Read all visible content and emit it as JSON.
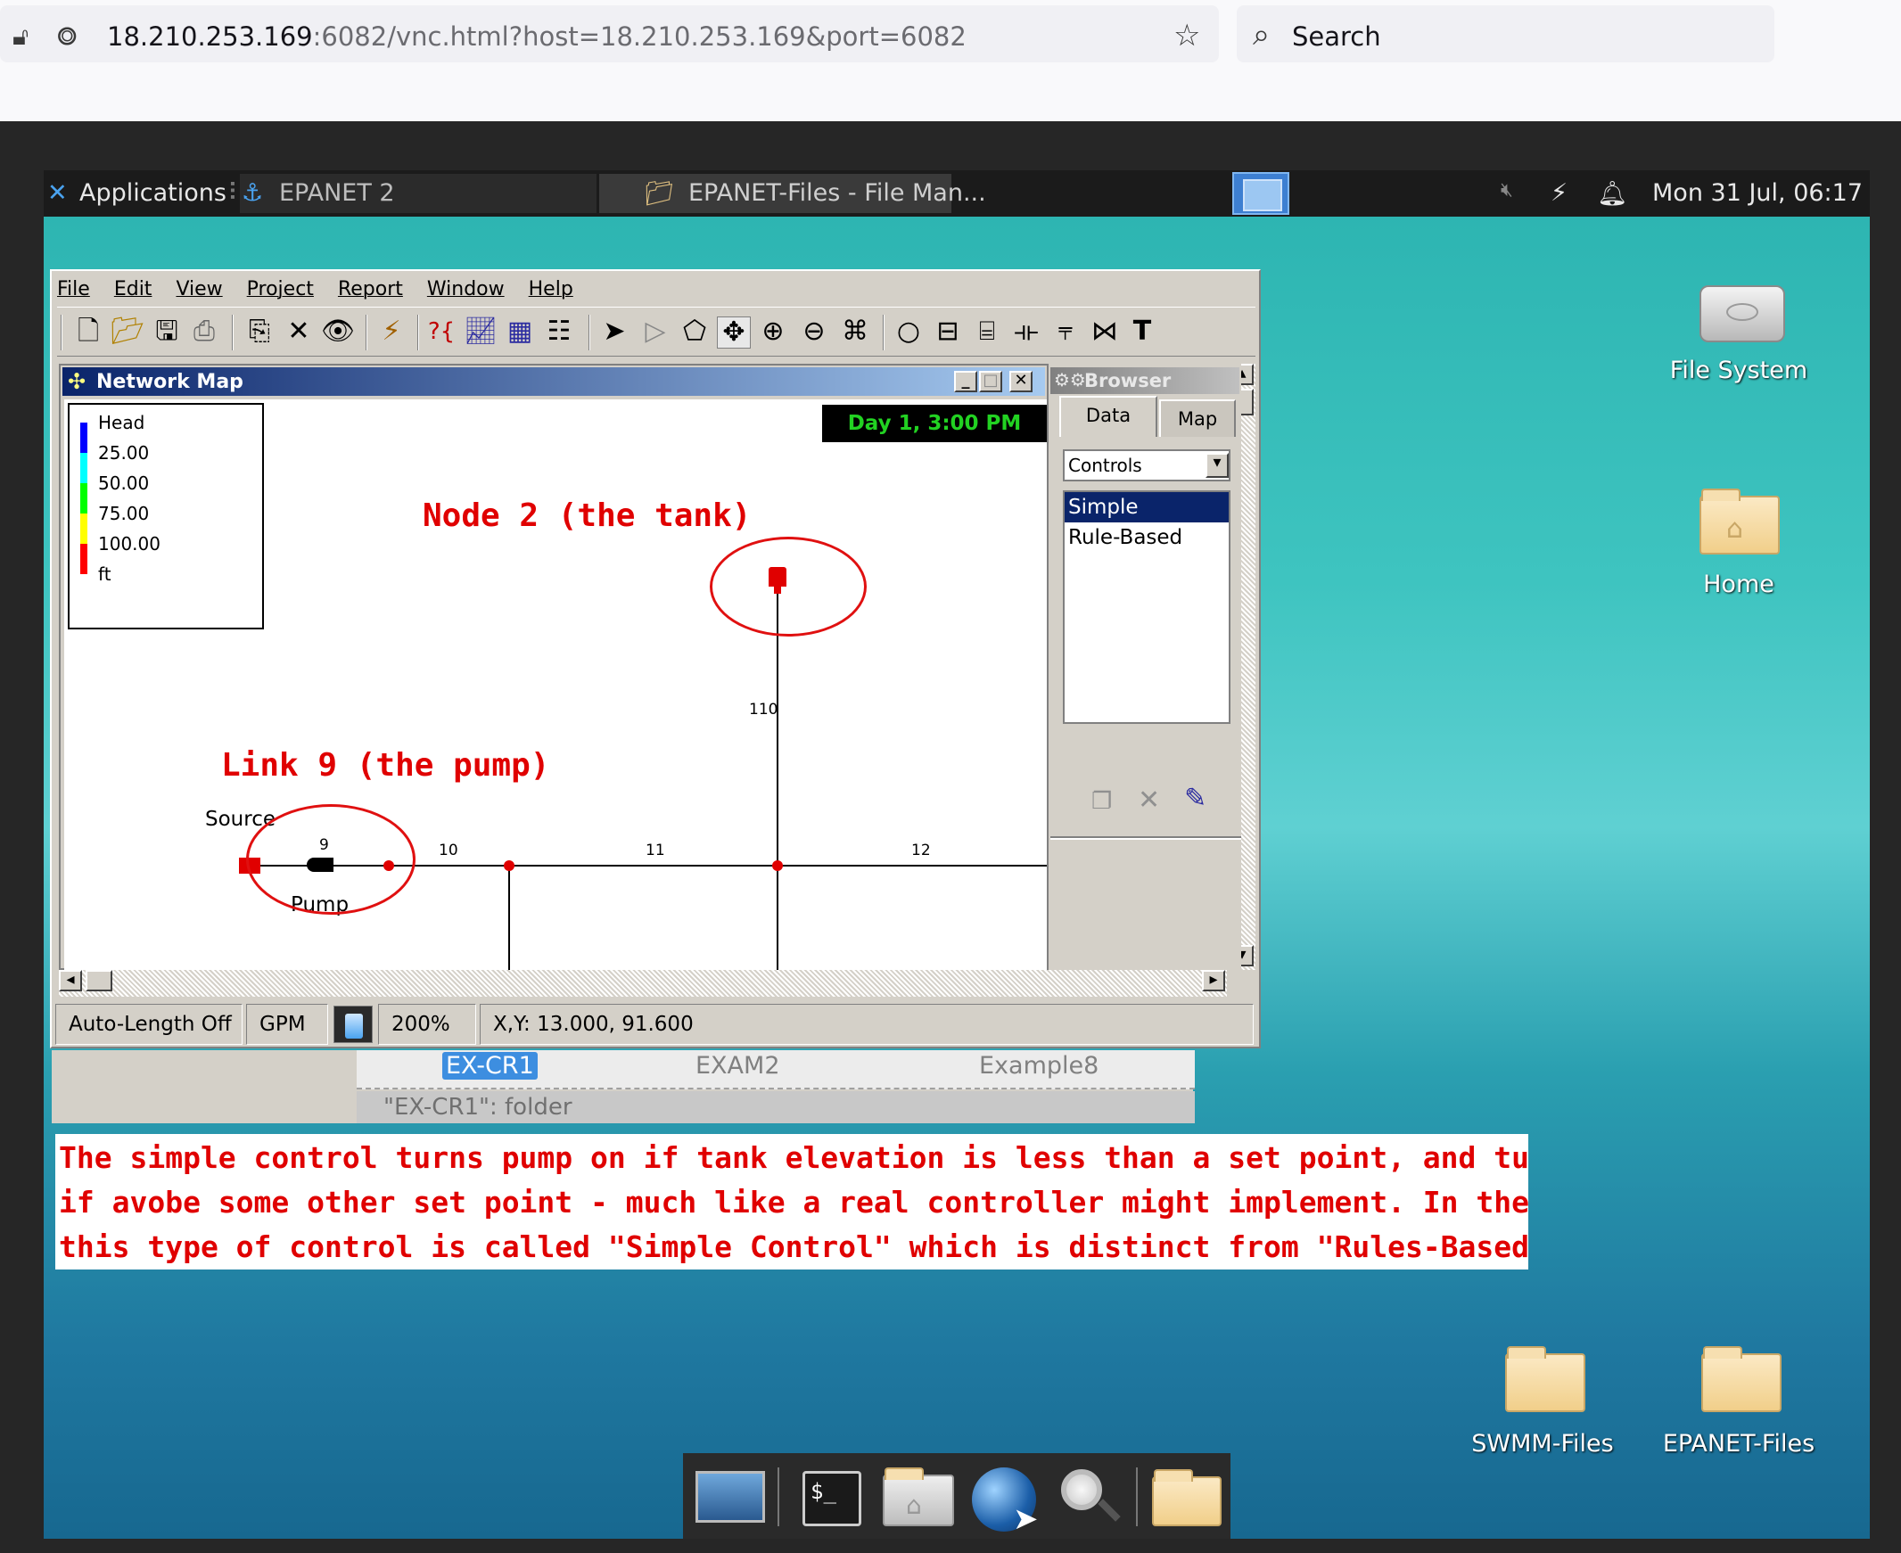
{
  "browser": {
    "url_host": "18.210.253.169",
    "url_rest": ":6082/vnc.html?host=18.210.253.169&port=6082",
    "search_placeholder": "Search"
  },
  "panel": {
    "applications": "Applications",
    "task_epanet": "EPANET 2",
    "task_files": "EPANET-Files - File Man...",
    "clock": "Mon 31 Jul, 06:17"
  },
  "desktop_icons": {
    "file_system": "File System",
    "home": "Home",
    "swmm": "SWMM-Files",
    "epanet": "EPANET-Files"
  },
  "epanet": {
    "menu": [
      "File",
      "Edit",
      "View",
      "Project",
      "Report",
      "Window",
      "Help"
    ],
    "netmap_title": "Network Map",
    "legend": {
      "title": "Head",
      "labels": [
        "25.00",
        "50.00",
        "75.00",
        "100.00"
      ],
      "unit": "ft",
      "colors": [
        "#0000ff",
        "#00ffff",
        "#00ff00",
        "#ffff00",
        "#ff0000"
      ]
    },
    "time_display": "Day 1, 3:00 PM",
    "annotations": {
      "tank": "Node 2 (the tank)",
      "pump": "Link 9 (the pump)"
    },
    "map_labels": {
      "source": "Source",
      "pump": "Pump",
      "link9": "9",
      "link10": "10",
      "link11": "11",
      "link12": "12",
      "link110": "110"
    },
    "browser": {
      "title": "Browser",
      "tab_data": "Data",
      "tab_map": "Map",
      "category": "Controls",
      "items": [
        "Simple",
        "Rule-Based"
      ]
    },
    "status": {
      "auto_length": "Auto-Length Off",
      "flow_units": "GPM",
      "zoom": "200%",
      "xy": "X,Y: 13.000, 91.600"
    }
  },
  "filemgr": {
    "items": [
      "EX-CR1",
      "EXAM2",
      "Example8"
    ],
    "status": "\"EX-CR1\": folder"
  },
  "note": [
    "The simple control turns pump on if tank elevation is less than a set point, and turns it off",
    "if avobe some other set point - much like a real controller might implement.  In the program",
    "this type of control is called \"Simple Control\" which is distinct from \"Rules-Based Control\""
  ]
}
